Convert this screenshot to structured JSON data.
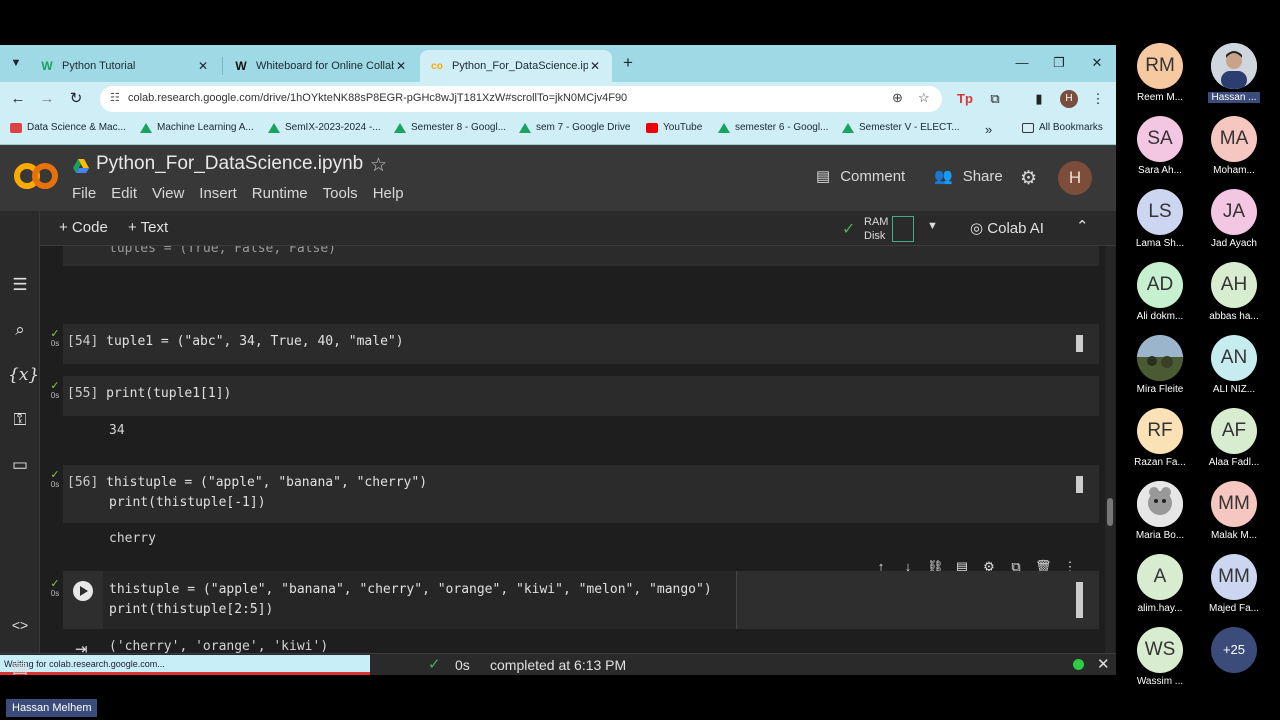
{
  "browser": {
    "tabs": [
      {
        "label": "Python Tutorial",
        "icon": "W"
      },
      {
        "label": "Whiteboard for Online Collabor",
        "icon": "W"
      },
      {
        "label": "Python_For_DataScience.ipynb",
        "icon": "co"
      }
    ],
    "url": "colab.research.google.com/drive/1hOYkteNK88sP8EGR-pGHc8wJjT181XzW#scrollTo=jkN0MCjv4F90",
    "bookmarks": [
      "Data Science & Mac...",
      "Machine Learning A...",
      "SemIX-2023-2024 -...",
      "Semester 8 - Googl...",
      "sem 7 - Google Drive",
      "YouTube",
      "semester 6 - Googl...",
      "Semester V - ELECT..."
    ],
    "all_bookmarks": "All Bookmarks",
    "profile_initial": "H"
  },
  "colab": {
    "logo": "CO",
    "title": "Python_For_DataScience.ipynb",
    "menu": [
      "File",
      "Edit",
      "View",
      "Insert",
      "Runtime",
      "Tools",
      "Help"
    ],
    "comment": "Comment",
    "share": "Share",
    "user_initial": "H",
    "toolbar": {
      "code": "+ Code",
      "text": "+ Text",
      "ram": "RAM",
      "disk": "Disk",
      "colab_ai": "Colab AI"
    }
  },
  "cells": {
    "partial_top": "tuples = (True, False, False)",
    "c54": {
      "count": "[54]",
      "time": "0s",
      "code": "tuple1 = (\"abc\", 34, True, 40, \"male\")"
    },
    "c55": {
      "count": "[55]",
      "time": "0s",
      "code": "print(tuple1[1])",
      "output": "34"
    },
    "c56": {
      "count": "[56]",
      "time": "0s",
      "code1": "thistuple = (\"apple\", \"banana\", \"cherry\")",
      "code2": "print(thistuple[-1])",
      "output": "cherry"
    },
    "current": {
      "time": "0s",
      "code1": "thistuple = (\"apple\", \"banana\", \"cherry\", \"orange\", \"kiwi\", \"melon\", \"mango\")",
      "code2": "print(thistuple[2:5])",
      "output": "('cherry', 'orange', 'kiwi')"
    }
  },
  "status": {
    "waiting": "Waiting for colab.research.google.com...",
    "time": "0s",
    "completed": "completed at 6:13 PM"
  },
  "presenter": "Hassan Melhem",
  "participants": [
    {
      "initials": "RM",
      "name": "Reem M...",
      "color": "#f6c9a0"
    },
    {
      "initials": "",
      "name": "Hassan ...",
      "color": "#c8d0d8"
    },
    {
      "initials": "SA",
      "name": "Sara Ah...",
      "color": "#f3c6e2"
    },
    {
      "initials": "MA",
      "name": "Moham...",
      "color": "#f5c7c0"
    },
    {
      "initials": "LS",
      "name": "Lama Sh...",
      "color": "#cdd6f0"
    },
    {
      "initials": "JA",
      "name": "Jad Ayach",
      "color": "#f3c6e2"
    },
    {
      "initials": "AD",
      "name": "Ali dokm...",
      "color": "#c6f0d0"
    },
    {
      "initials": "AH",
      "name": "abbas ha...",
      "color": "#d8edd0"
    },
    {
      "initials": "",
      "name": "Mira Fleite",
      "color": "#8ab"
    },
    {
      "initials": "AN",
      "name": "ALI NIZ...",
      "color": "#c6ecef"
    },
    {
      "initials": "RF",
      "name": "Razan Fa...",
      "color": "#fbe2b6"
    },
    {
      "initials": "AF",
      "name": "Alaa Fadl...",
      "color": "#d8edd0"
    },
    {
      "initials": "",
      "name": "Maria Bo...",
      "color": "#ddd"
    },
    {
      "initials": "MM",
      "name": "Malak M...",
      "color": "#f5c7c0"
    },
    {
      "initials": "A",
      "name": "alim.hay...",
      "color": "#d8edd0"
    },
    {
      "initials": "MM",
      "name": "Majed Fa...",
      "color": "#cdd6f0"
    },
    {
      "initials": "WS",
      "name": "Wassim ...",
      "color": "#d8edd0"
    },
    {
      "initials": "+25",
      "name": "",
      "color": "#3b4b7a"
    }
  ]
}
